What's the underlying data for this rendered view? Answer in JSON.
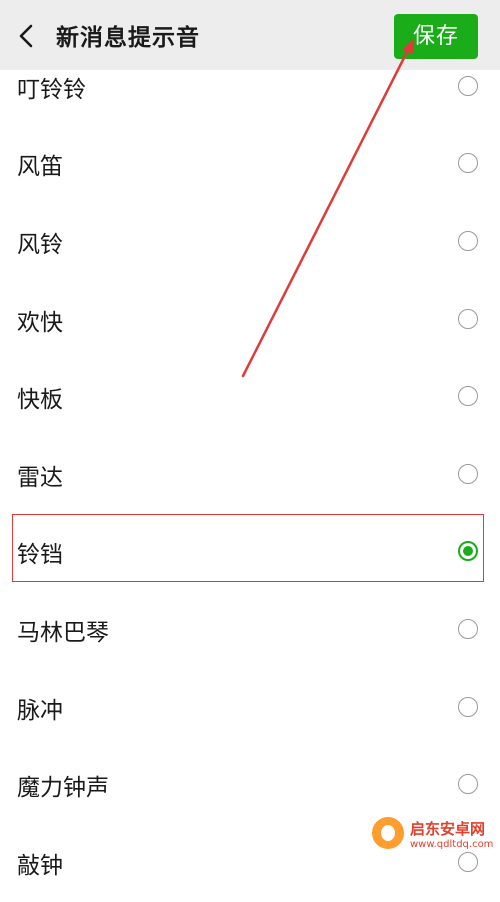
{
  "header": {
    "back_icon": "chevron-left-icon",
    "title": "新消息提示音",
    "save_label": "保存",
    "save_color": "#1aad19"
  },
  "ringtones": {
    "items": [
      {
        "label": "叮铃铃",
        "selected": false
      },
      {
        "label": "风笛",
        "selected": false
      },
      {
        "label": "风铃",
        "selected": false
      },
      {
        "label": "欢快",
        "selected": false
      },
      {
        "label": "快板",
        "selected": false
      },
      {
        "label": "雷达",
        "selected": false
      },
      {
        "label": "铃铛",
        "selected": true
      },
      {
        "label": "马林巴琴",
        "selected": false
      },
      {
        "label": "脉冲",
        "selected": false
      },
      {
        "label": "魔力钟声",
        "selected": false
      },
      {
        "label": "敲钟",
        "selected": false
      }
    ]
  },
  "annotation": {
    "color": "#e03b3b"
  },
  "watermark": {
    "name": "启东安卓网",
    "url": "www.qdltdq.com"
  }
}
